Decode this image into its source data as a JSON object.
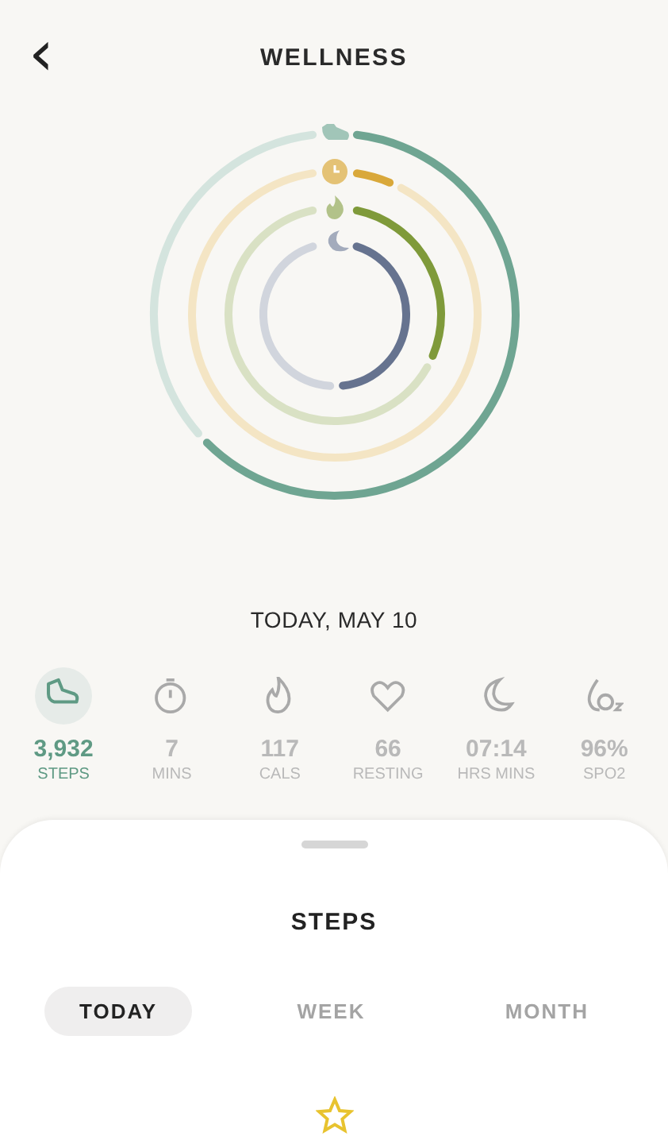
{
  "header": {
    "back": "‹",
    "title": "WELLNESS"
  },
  "rings": [
    {
      "kind": "steps",
      "color": "#6fa592"
    },
    {
      "kind": "minutes",
      "color": "#d9a83a"
    },
    {
      "kind": "calories",
      "color": "#7f9a3a"
    },
    {
      "kind": "sleep",
      "color": "#66738f"
    }
  ],
  "date": "TODAY, MAY 10",
  "metrics": [
    {
      "kind": "steps",
      "value": "3,932",
      "label": "STEPS",
      "selected": true
    },
    {
      "kind": "minutes",
      "value": "7",
      "label": "MINS",
      "selected": false
    },
    {
      "kind": "calories",
      "value": "117",
      "label": "CALS",
      "selected": false
    },
    {
      "kind": "heart",
      "value": "66",
      "label": "RESTING",
      "selected": false
    },
    {
      "kind": "sleep",
      "value": "07:14",
      "label": "HRS MINS",
      "selected": false
    },
    {
      "kind": "spo2",
      "value": "96%",
      "label": "SPO2",
      "selected": false
    }
  ],
  "sheet": {
    "title": "STEPS",
    "tabs": [
      {
        "label": "TODAY",
        "selected": true
      },
      {
        "label": "WEEK",
        "selected": false
      },
      {
        "label": "MONTH",
        "selected": false
      }
    ]
  }
}
